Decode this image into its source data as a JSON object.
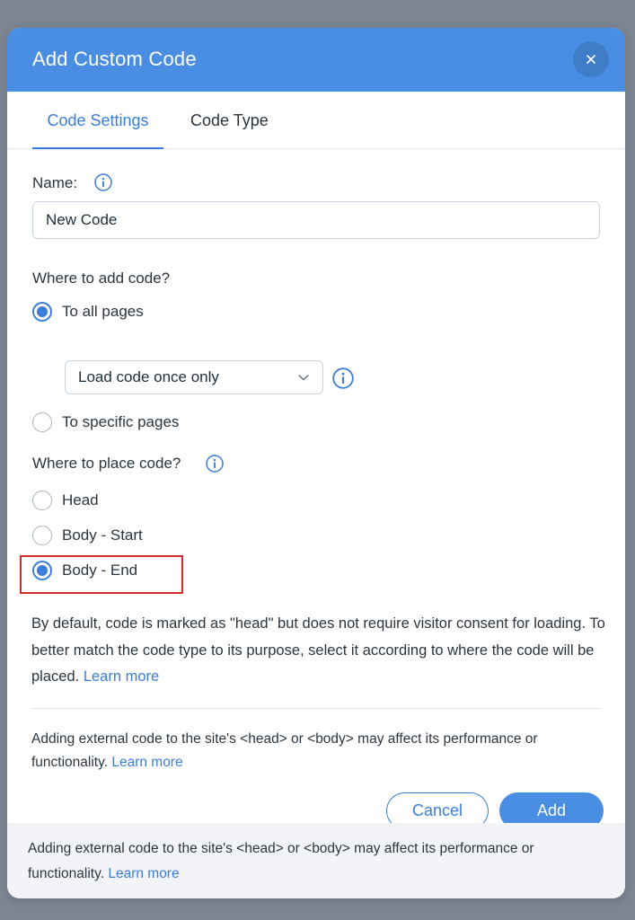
{
  "dialog": {
    "title": "Add Custom Code",
    "close_icon": "close-icon"
  },
  "tabs": [
    {
      "label": "Code Settings",
      "active": true
    },
    {
      "label": "Code Type",
      "active": false
    }
  ],
  "name_field": {
    "label": "Name:",
    "value": "New Code",
    "info_icon": "info-icon"
  },
  "where_to_add": {
    "label": "Where to add code?",
    "options": [
      {
        "label": "To all pages",
        "checked": true
      },
      {
        "label": "To specific pages",
        "checked": false
      }
    ],
    "load_dropdown": {
      "selected": "Load code once only",
      "icon": "chevron-down-icon"
    }
  },
  "where_to_place": {
    "label": "Where to place code?",
    "options": [
      {
        "label": "Head",
        "checked": false
      },
      {
        "label": "Body - Start",
        "checked": false
      },
      {
        "label": "Body - End",
        "checked": true
      }
    ]
  },
  "description": {
    "text": "By default, code is marked as \"head\" but does not require visitor consent for loading. To better match the code type to its purpose, select it according to where the code will be placed.",
    "link": "Learn more"
  },
  "warning": {
    "text": "Adding external code to the site's <head> or <body> may affect its performance or functionality.",
    "link": "Learn more"
  },
  "buttons": {
    "cancel": "Cancel",
    "add": "Add"
  },
  "footer": {
    "text": "Adding external code to the site's <head> or <body> may affect its performance or functionality.",
    "link": "Learn more"
  },
  "colors": {
    "accent": "#3b7ed9",
    "header": "#4a8ee3",
    "highlight": "#d42b2b"
  }
}
